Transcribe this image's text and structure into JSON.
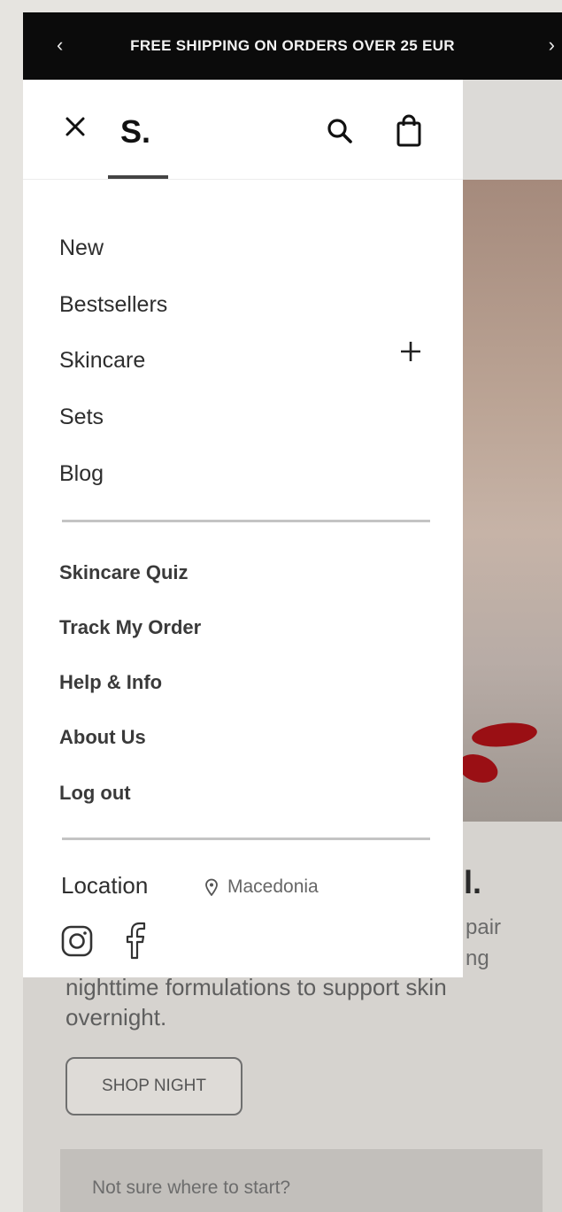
{
  "promo": {
    "text": "FREE SHIPPING ON ORDERS OVER 25 EUR",
    "prev_icon": "chevron-left-icon",
    "next_icon": "chevron-right-icon"
  },
  "drawer": {
    "logo": "S.",
    "icons": [
      "close-icon",
      "search-icon",
      "shopping-bag-icon"
    ],
    "primary_nav": [
      {
        "label": "New"
      },
      {
        "label": "Bestsellers"
      },
      {
        "label": "Skincare",
        "expand_icon": "plus-icon"
      },
      {
        "label": "Sets"
      },
      {
        "label": "Blog"
      }
    ],
    "secondary_nav": [
      {
        "label": "Skincare Quiz"
      },
      {
        "label": "Track My Order"
      },
      {
        "label": "Help & Info"
      },
      {
        "label": "About Us"
      },
      {
        "label": "Log out"
      }
    ],
    "location_label": "Location",
    "location_value": "Macedonia",
    "social": [
      "instagram-icon",
      "facebook-icon"
    ]
  },
  "background": {
    "heading_fragment": "l.",
    "fragment_1": "pair",
    "fragment_2": "ng",
    "description": "nighttime formulations to support skin overnight.",
    "shop_button": "SHOP NIGHT",
    "start_text": "Not sure where to start?"
  },
  "colors": {
    "banner_bg": "#0b0b0b",
    "drawer_bg": "#ffffff",
    "text_dark": "#2e2e2e",
    "accent_red": "#9a0f14"
  }
}
